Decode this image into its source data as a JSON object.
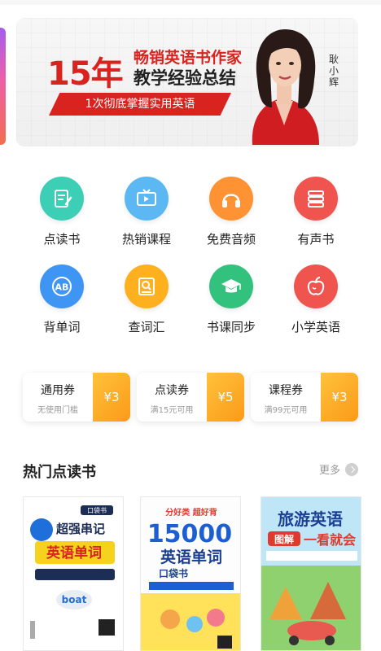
{
  "banner": {
    "year": "15年",
    "line1": "畅销英语书作家",
    "line2": "教学经验总结",
    "ribbon": "1次彻底掌握实用英语",
    "author": "耿小辉"
  },
  "menu": [
    {
      "label": "点读书",
      "icon": "book-read-icon",
      "color": "#3ccfb6"
    },
    {
      "label": "热销课程",
      "icon": "tv-icon",
      "color": "#5bb8f2"
    },
    {
      "label": "免费音频",
      "icon": "headphones-icon",
      "color": "#ff9232"
    },
    {
      "label": "有声书",
      "icon": "stacked-books-icon",
      "color": "#f0544f"
    },
    {
      "label": "背单词",
      "icon": "ab-letters-icon",
      "color": "#3f95f4"
    },
    {
      "label": "查词汇",
      "icon": "dictionary-search-icon",
      "color": "#ffb01f"
    },
    {
      "label": "书课同步",
      "icon": "graduation-cap-icon",
      "color": "#32c27d"
    },
    {
      "label": "小学英语",
      "icon": "apple-icon",
      "color": "#f0544f"
    }
  ],
  "coupons": [
    {
      "title": "通用券",
      "sub": "无使用门槛",
      "amount": "¥3"
    },
    {
      "title": "点读券",
      "sub": "满15元可用",
      "amount": "¥5"
    },
    {
      "title": "课程券",
      "sub": "满99元可用",
      "amount": "¥3"
    }
  ],
  "section": {
    "title": "热门点读书",
    "more": "更多"
  },
  "books": [
    {
      "badge": "口袋书",
      "line1": "超强串记",
      "line2": "英语单词",
      "tag": "boat"
    },
    {
      "top": "分好类 超好背",
      "line1": "15000",
      "line2": "英语单词",
      "line3": "口袋书"
    },
    {
      "line1": "旅游英语",
      "line2": "图解",
      "line3": "一看就会",
      "tag": "一看就会"
    }
  ]
}
